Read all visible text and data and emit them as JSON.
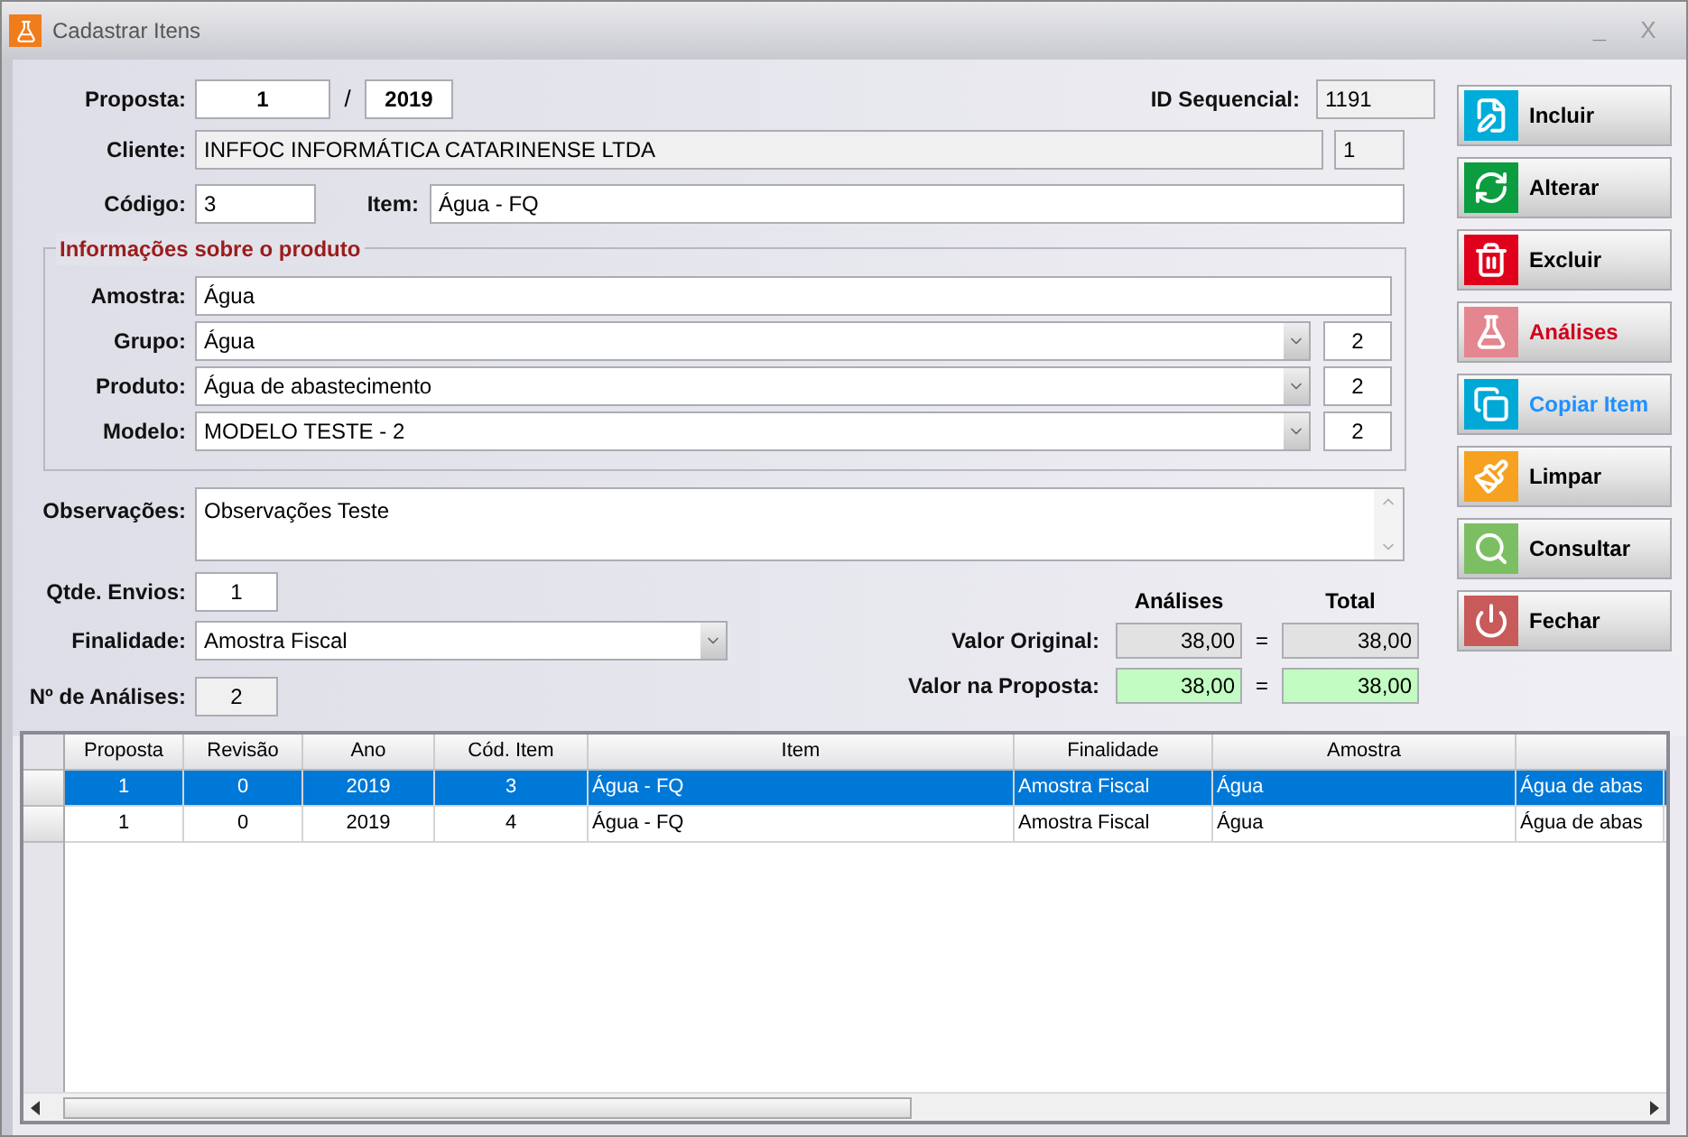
{
  "window": {
    "title": "Cadastrar Itens",
    "minimize": "_",
    "close": "X"
  },
  "header": {
    "proposta": {
      "label": "Proposta:",
      "number": "1",
      "separator": "/",
      "year": "2019"
    },
    "id_sequencial": {
      "label": "ID Sequencial:",
      "value": "1191"
    },
    "cliente": {
      "label": "Cliente:",
      "value": "INFFOC INFORMÁTICA CATARINENSE LTDA",
      "code": "1"
    },
    "codigo": {
      "label": "Código:",
      "value": "3"
    },
    "item": {
      "label": "Item:",
      "value": "Água - FQ"
    }
  },
  "product_info": {
    "title": "Informações sobre o produto",
    "fields": [
      {
        "kind": "text",
        "label": "Amostra:",
        "value": "Água"
      },
      {
        "kind": "combo",
        "label": "Grupo:",
        "value": "Água",
        "code": "2"
      },
      {
        "kind": "combo",
        "label": "Produto:",
        "value": "Água de abastecimento",
        "code": "2"
      },
      {
        "kind": "combo",
        "label": "Modelo:",
        "value": "MODELO TESTE - 2",
        "code": "2"
      }
    ]
  },
  "observacoes": {
    "label": "Observações:",
    "value": "Observações Teste"
  },
  "qtde_envios": {
    "label": "Qtde. Envios:",
    "value": "1"
  },
  "finalidade": {
    "label": "Finalidade:",
    "value": "Amostra Fiscal"
  },
  "n_analises": {
    "label": "Nº de Análises:",
    "value": "2"
  },
  "values": {
    "headers": [
      "Análises",
      "Total"
    ],
    "rows": [
      {
        "label": "Valor Original:",
        "analises": "38,00",
        "equals": "=",
        "total": "38,00",
        "highlighted": false
      },
      {
        "label": "Valor na Proposta:",
        "analises": "38,00",
        "equals": "=",
        "total": "38,00",
        "highlighted": true
      }
    ]
  },
  "buttons": [
    {
      "label": "Incluir",
      "kind": "add"
    },
    {
      "label": "Alterar",
      "kind": "edit"
    },
    {
      "label": "Excluir",
      "kind": "delete"
    },
    {
      "label": "Análises",
      "kind": "analyses"
    },
    {
      "label": "Copiar Item",
      "kind": "copy"
    },
    {
      "label": "Limpar",
      "kind": "clear"
    },
    {
      "label": "Consultar",
      "kind": "search"
    },
    {
      "label": "Fechar",
      "kind": "close"
    }
  ],
  "table": {
    "columns": [
      "Proposta",
      "Revisão",
      "Ano",
      "Cód. Item",
      "Item",
      "Finalidade",
      "Amostra"
    ],
    "rows": [
      {
        "selected": true,
        "cells": [
          "1",
          "0",
          "2019",
          "3",
          "Água - FQ",
          "Amostra Fiscal",
          "Água",
          "Água de abas"
        ]
      },
      {
        "selected": false,
        "cells": [
          "1",
          "0",
          "2019",
          "4",
          "Água - FQ",
          "Amostra Fiscal",
          "Água",
          "Água de abas"
        ]
      }
    ]
  }
}
